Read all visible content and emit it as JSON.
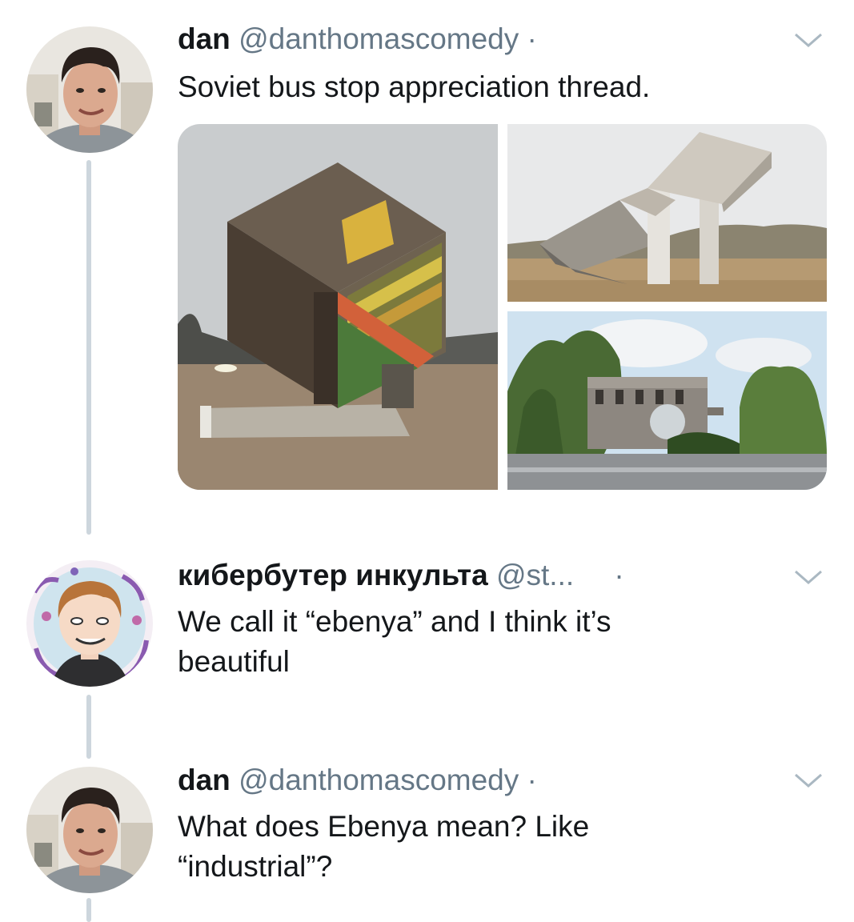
{
  "tweets": [
    {
      "name": "dan",
      "handle": "@danthomascomedy",
      "dot": "·",
      "text": "Soviet bus stop appreciation thread."
    },
    {
      "name": "кибербутер инкульта",
      "handle": "@st...",
      "dot": "·",
      "text": "We call it “ebenya” and I think it’s beautiful"
    },
    {
      "name": "dan",
      "handle": "@danthomascomedy",
      "dot": "·",
      "text": "What does Ebenya mean? Like “industrial”?"
    }
  ],
  "icons": {
    "more": "chevron-down-icon"
  },
  "colors": {
    "text": "#14171a",
    "secondary": "#657786",
    "thread_line": "#cdd6dd",
    "background": "#ffffff"
  }
}
